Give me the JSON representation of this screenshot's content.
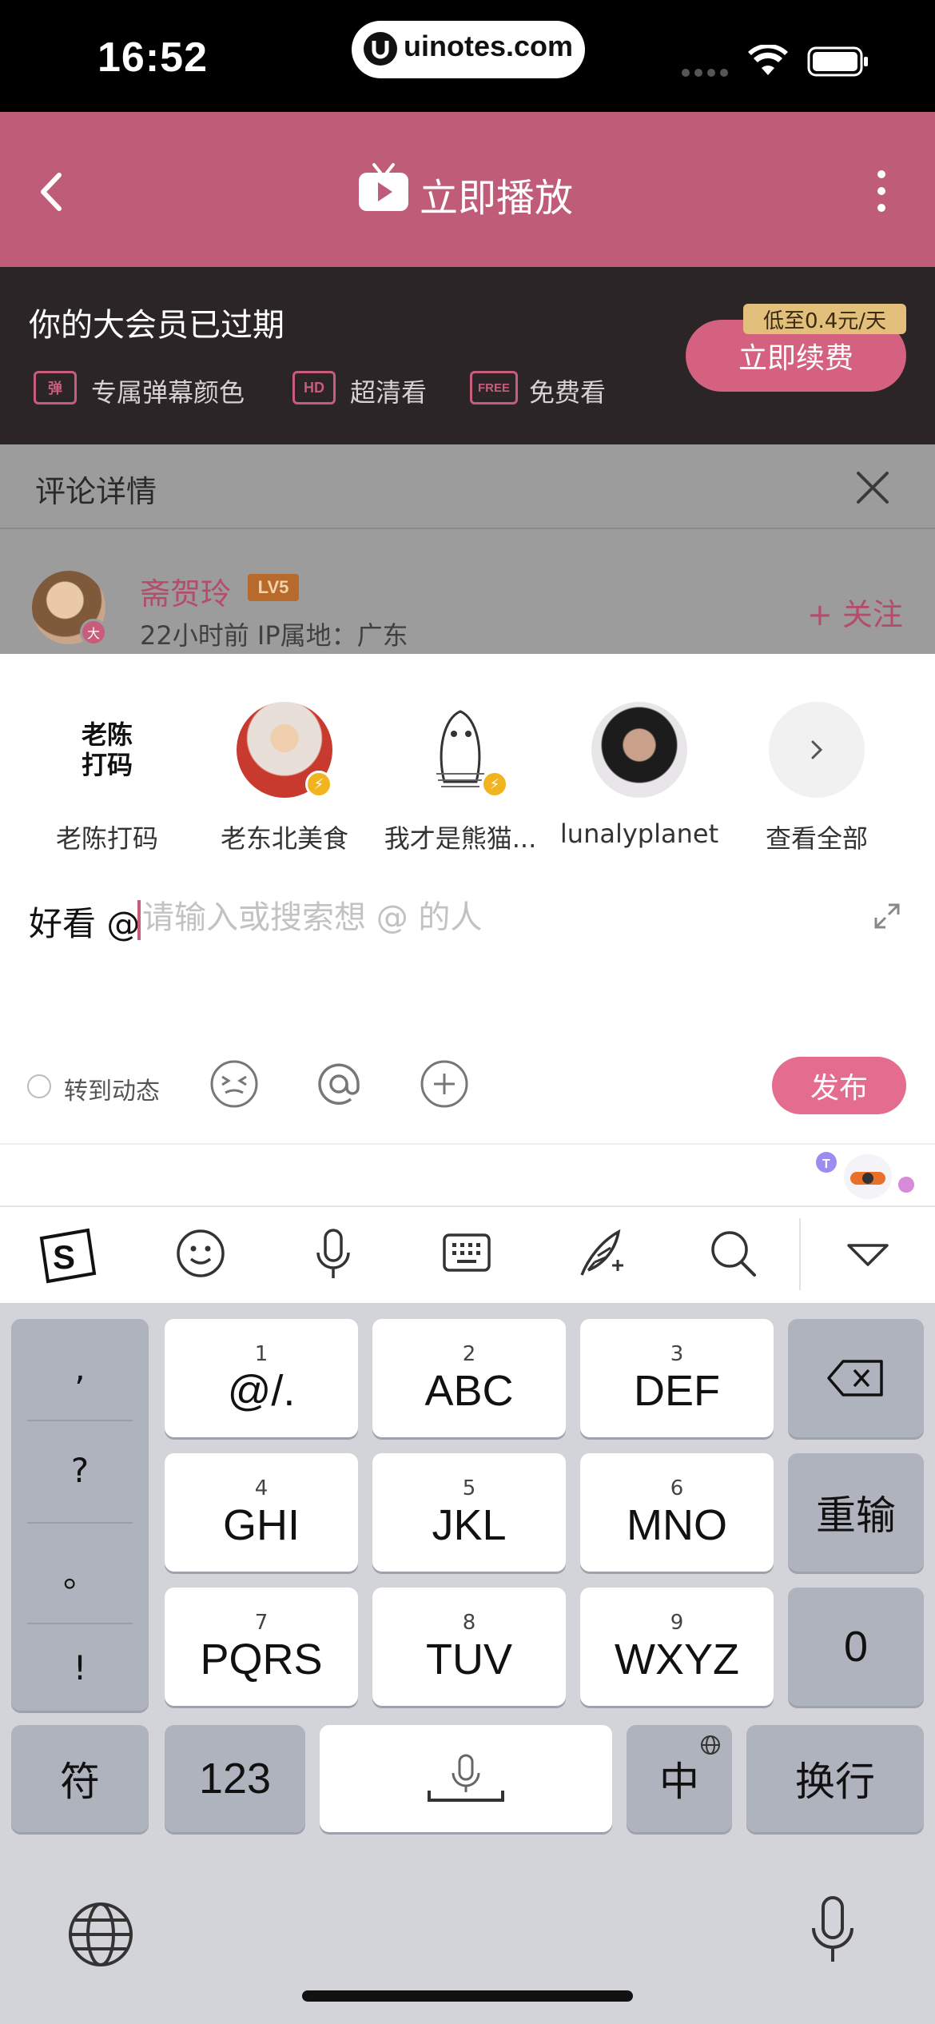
{
  "status_bar": {
    "time": "16:52",
    "url": "uinotes.com"
  },
  "header": {
    "title": "立即播放"
  },
  "vip_banner": {
    "title": "你的大会员已过期",
    "perks": [
      {
        "icon": "弹",
        "label": "专属弹幕颜色"
      },
      {
        "icon": "HD",
        "label": "超清看"
      },
      {
        "icon": "FREE",
        "label": "免费看"
      }
    ],
    "renew_label": "立即续费",
    "price_tag": "低至0.4元/天",
    "avatar_badge": "大"
  },
  "comment_detail": {
    "title": "评论详情",
    "user_name": "斋贺玲",
    "level": "LV5",
    "meta": "22小时前  IP属地：广东",
    "follow_label": "+ 关注"
  },
  "mentions": [
    {
      "name": "老陈打码",
      "avatar_text": "老陈\n打码"
    },
    {
      "name": "老东北美食"
    },
    {
      "name": "我才是熊猫..."
    },
    {
      "name": "lunalyplanet"
    },
    {
      "name": "查看全部"
    }
  ],
  "composer": {
    "typed_text": "好看 @",
    "placeholder": "请输入或搜索想 @ 的人",
    "repost_label": "转到动态",
    "publish_label": "发布"
  },
  "keyboard": {
    "punctuation": [
      ",",
      "?",
      "。",
      "!"
    ],
    "keys": [
      {
        "num": "1",
        "label": "@/."
      },
      {
        "num": "2",
        "label": "ABC"
      },
      {
        "num": "3",
        "label": "DEF"
      },
      {
        "num": "4",
        "label": "GHI"
      },
      {
        "num": "5",
        "label": "JKL"
      },
      {
        "num": "6",
        "label": "MNO"
      },
      {
        "num": "7",
        "label": "PQRS"
      },
      {
        "num": "8",
        "label": "TUV"
      },
      {
        "num": "9",
        "label": "WXYZ"
      }
    ],
    "reenter_label": "重输",
    "zero_label": "0",
    "symbols_label": "符",
    "numbers_label": "123",
    "lang_label": "中",
    "return_label": "换行"
  },
  "colors": {
    "accent": "#bf5c77",
    "publish": "#e46d8f",
    "vip_bg": "#2c2528"
  }
}
